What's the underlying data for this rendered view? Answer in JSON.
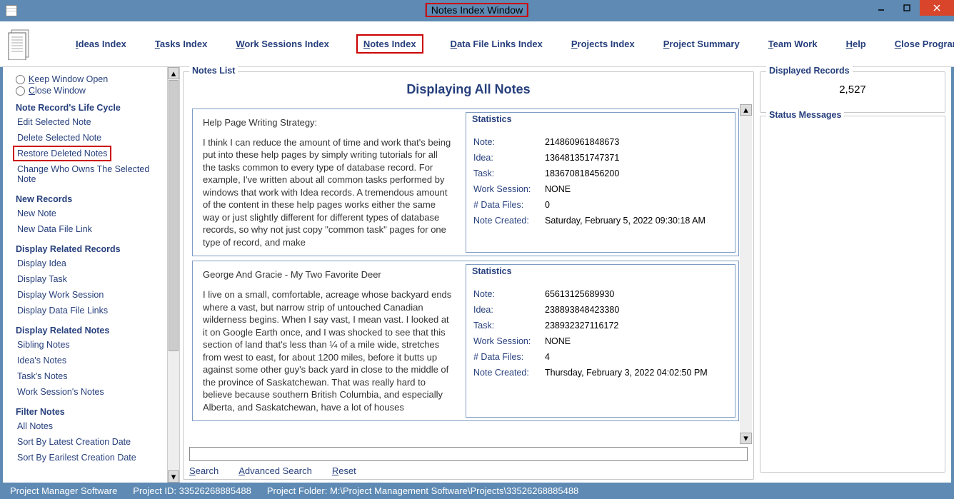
{
  "window": {
    "title": "Notes Index Window"
  },
  "menu": {
    "items": [
      {
        "label": "Ideas Index",
        "accel": "I"
      },
      {
        "label": "Tasks Index",
        "accel": "T"
      },
      {
        "label": "Work Sessions Index",
        "accel": "W"
      },
      {
        "label": "Notes Index",
        "accel": "N"
      },
      {
        "label": "Data File Links Index",
        "accel": "D"
      },
      {
        "label": "Projects Index",
        "accel": "P"
      },
      {
        "label": "Project Summary",
        "accel": "P"
      },
      {
        "label": "Team Work",
        "accel": "T"
      },
      {
        "label": "Help",
        "accel": "H"
      },
      {
        "label": "Close Program",
        "accel": "C"
      }
    ]
  },
  "sidebar": {
    "radios": {
      "keep": "Keep Window Open",
      "close": "Close Window"
    },
    "lifecycle": {
      "title": "Note Record's Life Cycle",
      "items": [
        "Edit Selected Note",
        "Delete Selected Note",
        "Restore Deleted Notes",
        "Change Who Owns The Selected Note"
      ]
    },
    "newrec": {
      "title": "New Records",
      "items": [
        "New Note",
        "New Data File Link"
      ]
    },
    "related": {
      "title": "Display Related Records",
      "items": [
        "Display Idea",
        "Display Task",
        "Display Work Session",
        "Display Data File Links"
      ]
    },
    "relnotes": {
      "title": "Display Related Notes",
      "items": [
        "Sibling Notes",
        "Idea's Notes",
        "Task's Notes",
        "Work Session's Notes"
      ]
    },
    "filter": {
      "title": "Filter Notes",
      "items": [
        "All Notes",
        "Sort By Latest Creation Date",
        "Sort By Earilest Creation Date"
      ]
    }
  },
  "center": {
    "group_label": "Notes List",
    "heading": "Displaying All Notes",
    "search_label": "Search",
    "adv_label": "Advanced Search",
    "reset_label": "Reset",
    "search_placeholder": ""
  },
  "notes": [
    {
      "title": "Help Page Writing Strategy:",
      "body": "I think I can reduce the amount of time and work that's being put into these help pages by simply writing tutorials for all the tasks common to every type of database record. For example, I've written about all common tasks performed by windows that work with Idea records. A tremendous amount of the content in these help pages works either the same way or just slightly different for different types of database records, so why not just copy \"common task\" pages for one type of record, and make",
      "stats": {
        "label": "Statistics",
        "note": "214860961848673",
        "idea": "136481351747371",
        "task": "183670818456200",
        "work_session": "NONE",
        "data_files": "0",
        "created": "Saturday, February 5, 2022   09:30:18 AM"
      }
    },
    {
      "title": "George And Gracie - My Two Favorite Deer",
      "body": "I live on a small, comfortable, acreage whose backyard ends where a vast, but narrow strip of untouched Canadian wilderness begins. When I say vast, I mean vast. I looked at it on Google Earth once, and I was shocked to see that this section of land that's less than ¼ of a mile wide, stretches from west to east, for about 1200 miles, before it butts up against some other guy's back yard in close to the middle of the province of Saskatchewan. That was really hard to believe because southern British Columbia, and especially Alberta, and Saskatchewan, have a lot of houses",
      "stats": {
        "label": "Statistics",
        "note": "65613125689930",
        "idea": "238893848423380",
        "task": "238932327116172",
        "work_session": "NONE",
        "data_files": "4",
        "created": "Thursday, February 3, 2022   04:02:50 PM"
      }
    }
  ],
  "stat_keys": {
    "note": "Note:",
    "idea": "Idea:",
    "task": "Task:",
    "ws": "Work Session:",
    "df": "# Data Files:",
    "created": "Note Created:"
  },
  "right": {
    "disp_label": "Displayed Records",
    "disp_value": "2,527",
    "status_label": "Status Messages"
  },
  "status": {
    "app": "Project Manager Software",
    "proj_id": "Project ID:  33526268885488",
    "proj_folder": "Project Folder:  M:\\Project Management Software\\Projects\\33526268885488"
  }
}
